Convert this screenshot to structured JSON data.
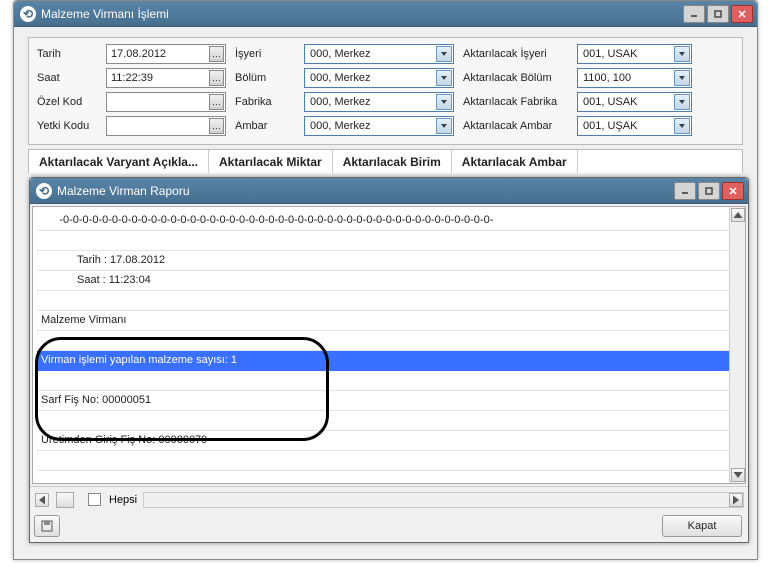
{
  "outer": {
    "title": "Malzeme Virmanı İşlemi",
    "form": {
      "left": {
        "tarih_label": "Tarih",
        "tarih_value": "17.08.2012",
        "saat_label": "Saat",
        "saat_value": "11:22:39",
        "ozelkod_label": "Özel Kod",
        "ozelkod_value": "",
        "yetki_label": "Yetki Kodu",
        "yetki_value": ""
      },
      "mid": {
        "isyeri_label": "İşyeri",
        "isyeri_value": "000, Merkez",
        "bolum_label": "Bölüm",
        "bolum_value": "000, Merkez",
        "fabrika_label": "Fabrika",
        "fabrika_value": "000, Merkez",
        "ambar_label": "Ambar",
        "ambar_value": "000, Merkez"
      },
      "right": {
        "a_isyeri_label": "Aktarılacak İşyeri",
        "a_isyeri_value": "001, USAK",
        "a_bolum_label": "Aktarılacak Bölüm",
        "a_bolum_value": "1100, 100",
        "a_fabrika_label": "Aktarılacak Fabrika",
        "a_fabrika_value": "001, USAK",
        "a_ambar_label": "Aktarılacak Ambar",
        "a_ambar_value": "001, UŞAK"
      }
    },
    "tabs": {
      "t1": "Aktarılacak Varyant Açıkla...",
      "t2": "Aktarılacak Miktar",
      "t3": "Aktarılacak Birim",
      "t4": "Aktarılacak Ambar"
    }
  },
  "inner": {
    "title": "Malzeme Virman Raporu",
    "lines": {
      "dashes": "      -0-0-0-0-0-0-0-0-0-0-0-0-0-0-0-0-0-0-0-0-0-0-0-0-0-0-0-0-0-0-0-0-0-0-0-0-0-0-0-0-0-0-0-0-",
      "tarih_line": "Tarih : 17.08.2012",
      "saat_line": "Saat : 11:23:04",
      "title_line": "Malzeme Virmanı",
      "selected": "Virman işlemi yapılan malzeme sayısı: 1",
      "sarf": "Sarf Fiş No: 00000051",
      "uretim": "Üretimden Giriş Fiş No: 00000079"
    },
    "hepsi_label": "Hepsi",
    "kapat_label": "Kapat"
  }
}
